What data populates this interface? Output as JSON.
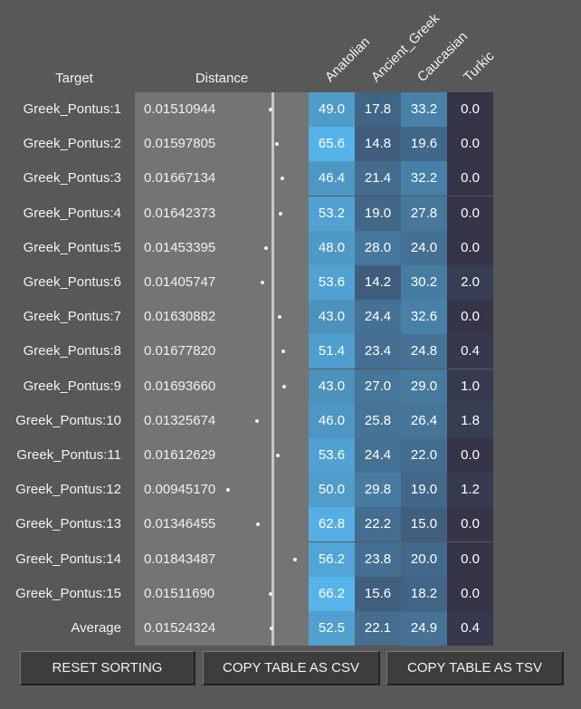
{
  "headers": {
    "target": "Target",
    "distance": "Distance",
    "populations": [
      "Anatolian",
      "Ancient_Greek",
      "Caucasian",
      "Turkic"
    ]
  },
  "rows": [
    {
      "target": "Greek_Pontus:1",
      "distance": "0.01510944",
      "values": [
        "49.0",
        "17.8",
        "33.2",
        "0.0"
      ]
    },
    {
      "target": "Greek_Pontus:2",
      "distance": "0.01597805",
      "values": [
        "65.6",
        "14.8",
        "19.6",
        "0.0"
      ]
    },
    {
      "target": "Greek_Pontus:3",
      "distance": "0.01667134",
      "values": [
        "46.4",
        "21.4",
        "32.2",
        "0.0"
      ]
    },
    {
      "target": "Greek_Pontus:4",
      "distance": "0.01642373",
      "values": [
        "53.2",
        "19.0",
        "27.8",
        "0.0"
      ]
    },
    {
      "target": "Greek_Pontus:5",
      "distance": "0.01453395",
      "values": [
        "48.0",
        "28.0",
        "24.0",
        "0.0"
      ]
    },
    {
      "target": "Greek_Pontus:6",
      "distance": "0.01405747",
      "values": [
        "53.6",
        "14.2",
        "30.2",
        "2.0"
      ]
    },
    {
      "target": "Greek_Pontus:7",
      "distance": "0.01630882",
      "values": [
        "43.0",
        "24.4",
        "32.6",
        "0.0"
      ]
    },
    {
      "target": "Greek_Pontus:8",
      "distance": "0.01677820",
      "values": [
        "51.4",
        "23.4",
        "24.8",
        "0.4"
      ]
    },
    {
      "target": "Greek_Pontus:9",
      "distance": "0.01693660",
      "values": [
        "43.0",
        "27.0",
        "29.0",
        "1.0"
      ]
    },
    {
      "target": "Greek_Pontus:10",
      "distance": "0.01325674",
      "values": [
        "46.0",
        "25.8",
        "26.4",
        "1.8"
      ]
    },
    {
      "target": "Greek_Pontus:11",
      "distance": "0.01612629",
      "values": [
        "53.6",
        "24.4",
        "22.0",
        "0.0"
      ]
    },
    {
      "target": "Greek_Pontus:12",
      "distance": "0.00945170",
      "values": [
        "50.0",
        "29.8",
        "19.0",
        "1.2"
      ]
    },
    {
      "target": "Greek_Pontus:13",
      "distance": "0.01346455",
      "values": [
        "62.8",
        "22.2",
        "15.0",
        "0.0"
      ]
    },
    {
      "target": "Greek_Pontus:14",
      "distance": "0.01843487",
      "values": [
        "56.2",
        "23.8",
        "20.0",
        "0.0"
      ]
    },
    {
      "target": "Greek_Pontus:15",
      "distance": "0.01511690",
      "values": [
        "66.2",
        "15.6",
        "18.2",
        "0.0"
      ]
    }
  ],
  "average": {
    "target": "Average",
    "distance": "0.01524324",
    "values": [
      "52.5",
      "22.1",
      "24.9",
      "0.4"
    ]
  },
  "buttons": {
    "reset": "RESET SORTING",
    "csv": "COPY TABLE AS CSV",
    "tsv": "COPY TABLE AS TSV"
  },
  "colors": {
    "background": "#585858",
    "distance_panel": "#747474",
    "distance_marker": "#c8c8c8",
    "heat_low": "#353547",
    "heat_high": "#56b4ea"
  }
}
